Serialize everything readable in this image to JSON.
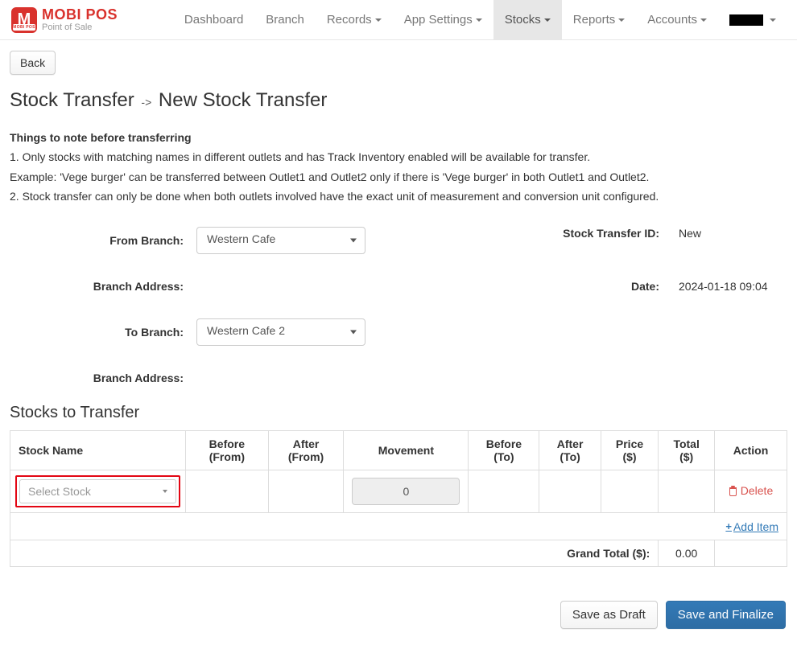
{
  "brand": {
    "name": "MOBI POS",
    "subtitle": "Point of Sale",
    "icon_letter": "M",
    "icon_band": "MOBI POS"
  },
  "nav": {
    "items": [
      {
        "label": "Dashboard",
        "dropdown": false
      },
      {
        "label": "Branch",
        "dropdown": false
      },
      {
        "label": "Records",
        "dropdown": true
      },
      {
        "label": "App Settings",
        "dropdown": true
      },
      {
        "label": "Stocks",
        "dropdown": true,
        "active": true
      },
      {
        "label": "Reports",
        "dropdown": true
      },
      {
        "label": "Accounts",
        "dropdown": true
      }
    ]
  },
  "back_button": "Back",
  "page_title": {
    "crumb": "Stock Transfer",
    "separator": "->",
    "current": "New Stock Transfer"
  },
  "notes": {
    "heading": "Things to note before transferring",
    "lines": [
      "1. Only stocks with matching names in different outlets and has Track Inventory enabled will be available for transfer.",
      "Example: 'Vege burger' can be transferred between Outlet1 and Outlet2 only if there is 'Vege burger' in both Outlet1 and Outlet2.",
      "2. Stock transfer can only be done when both outlets involved have the exact unit of measurement and conversion unit configured."
    ]
  },
  "form": {
    "from_branch_label": "From Branch:",
    "from_branch_value": "Western Cafe",
    "to_branch_label": "To Branch:",
    "to_branch_value": "Western Cafe 2",
    "branch_address_label": "Branch Address:",
    "stock_transfer_id_label": "Stock Transfer ID:",
    "stock_transfer_id_value": "New",
    "date_label": "Date:",
    "date_value": "2024-01-18 09:04"
  },
  "table": {
    "section_title": "Stocks to Transfer",
    "headers": {
      "stock_name": "Stock Name",
      "before_from": "Before (From)",
      "after_from": "After (From)",
      "movement": "Movement",
      "before_to": "Before (To)",
      "after_to": "After (To)",
      "price": "Price ($)",
      "total": "Total ($)",
      "action": "Action"
    },
    "row": {
      "stock_placeholder": "Select Stock",
      "movement_value": "0",
      "delete_label": "Delete"
    },
    "add_item_label": "Add Item",
    "grand_total_label": "Grand Total ($):",
    "grand_total_value": "0.00"
  },
  "footer": {
    "save_draft": "Save as Draft",
    "save_finalize": "Save and Finalize"
  }
}
